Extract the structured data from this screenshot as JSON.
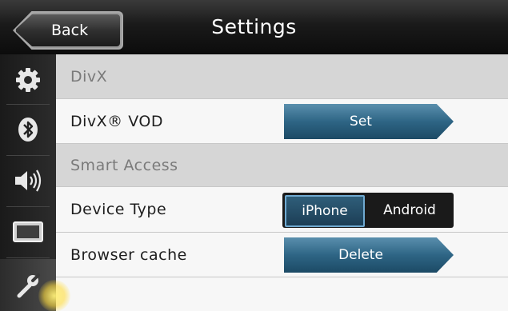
{
  "header": {
    "back_label": "Back",
    "title": "Settings"
  },
  "sidebar": {
    "items": [
      {
        "icon": "gear-icon",
        "active": false
      },
      {
        "icon": "bluetooth-icon",
        "active": false
      },
      {
        "icon": "speaker-icon",
        "active": false
      },
      {
        "icon": "display-icon",
        "active": false
      },
      {
        "icon": "wrench-icon",
        "active": true
      }
    ]
  },
  "settings": {
    "divx_section": "DivX",
    "divx_vod_label": "DivX® VOD",
    "divx_vod_button": "Set",
    "smart_access_section": "Smart Access",
    "device_type_label": "Device Type",
    "device_type_options": [
      "iPhone",
      "Android"
    ],
    "device_type_selected": "iPhone",
    "browser_cache_label": "Browser cache",
    "browser_cache_button": "Delete"
  },
  "colors": {
    "accent_button": "#2e6585",
    "selected_outline": "#6fa9d0",
    "section_header_bg": "#d6d6d6"
  }
}
